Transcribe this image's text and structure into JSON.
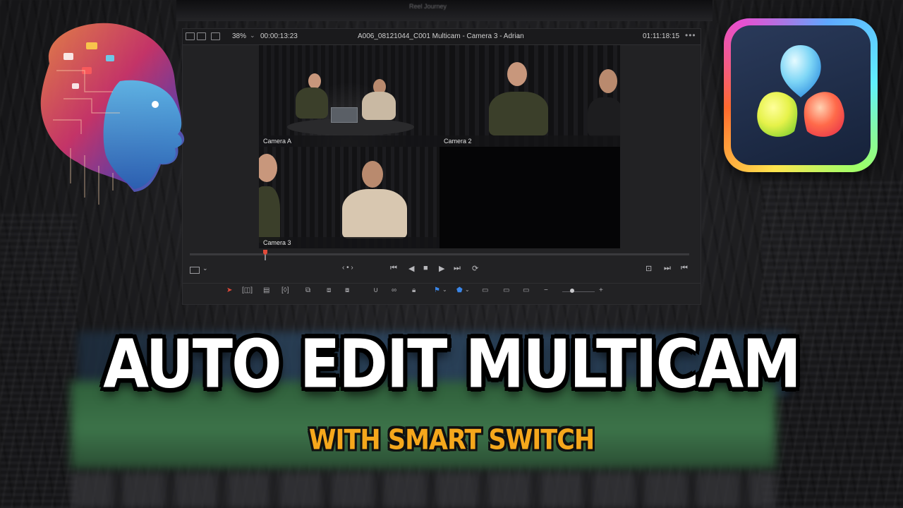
{
  "background": {
    "project_title": "Reel Journey"
  },
  "viewer": {
    "zoom": "38%",
    "source_timecode": "00:00:13:23",
    "clip_title": "A006_08121044_C001 Multicam - Camera 3 - Adrian",
    "record_timecode": "01:11:18:15",
    "angles": [
      {
        "label": "Camera A",
        "active": true
      },
      {
        "label": "Camera 2",
        "active": false
      },
      {
        "label": "Camera 3",
        "active": false
      },
      {
        "label": "",
        "active": false
      }
    ],
    "active_color": "#e06a4e"
  },
  "transport": {
    "jog_label": "‹ • ›",
    "first_frame": "⏮",
    "reverse": "◀",
    "stop": "■",
    "play": "▶",
    "last_frame": "⏭",
    "loop": "⟳",
    "match_frame": "⊡",
    "next_edit": "⏭",
    "prev_edit": "⏮"
  },
  "headline": {
    "title": "AUTO EDIT MULTICAM",
    "subtitle": "WITH SMART SWITCH",
    "title_color": "#ffffff",
    "subtitle_color": "#f5a71c"
  },
  "icons": {
    "brain": "ai-brain-illustration",
    "logo": "davinci-resolve-logo"
  }
}
